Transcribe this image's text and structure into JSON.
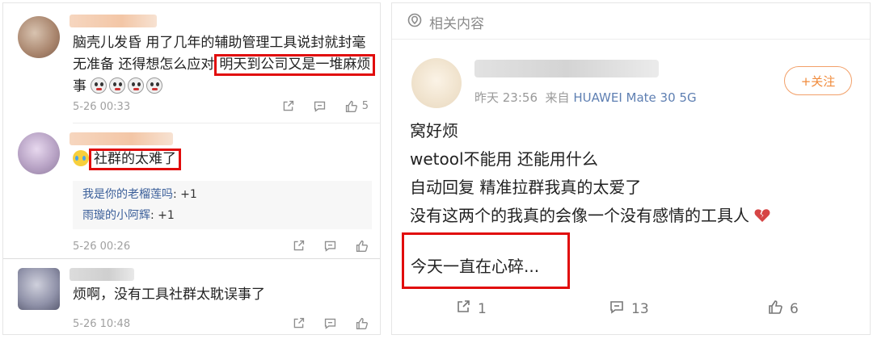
{
  "comments": [
    {
      "text_before": "脑壳儿发昏 用了几年的辅助管理工具说封就封毫无准备 还得想怎么应对",
      "text_line1": "脑壳儿发昏 用了几年的辅助管理工具说封就封毫",
      "text_line2": "无准备 还得想怎么应对",
      "highlight": "明天到公司又是一堆麻烦",
      "text_line3": "事",
      "time": "5-26 00:33",
      "likes": "5"
    },
    {
      "highlight": "社群的太难了",
      "replies": [
        {
          "user": "我是你的老榴莲吗",
          "text": ": +1"
        },
        {
          "user": "雨璇的小阿辉",
          "text": ": +1"
        }
      ],
      "time": "5-26 00:26"
    },
    {
      "text": "烦啊，没有工具社群太耽误事了",
      "time": "5-26 10:48"
    }
  ],
  "related": {
    "header": "相关内容",
    "post": {
      "time": "昨天 23:56",
      "from": "来自",
      "device": "HUAWEI Mate 30 5G",
      "follow_label": "+关注",
      "lines": [
        "窝好烦",
        "wetool不能用 还能用什么",
        "自动回复 精准拉群我真的太爱了",
        "没有这两个的我真的会像一个没有感情的工具人"
      ],
      "highlight": "今天一直在心碎...",
      "shares": "1",
      "comments": "13",
      "likes": "6"
    }
  },
  "colors": {
    "highlight_border": "#e10c0c",
    "follow_orange": "#f08a3a",
    "link_blue": "#3b5f9a"
  },
  "icons": [
    "share-icon",
    "comment-icon",
    "like-icon",
    "location-pin-icon",
    "broken-heart-icon"
  ]
}
